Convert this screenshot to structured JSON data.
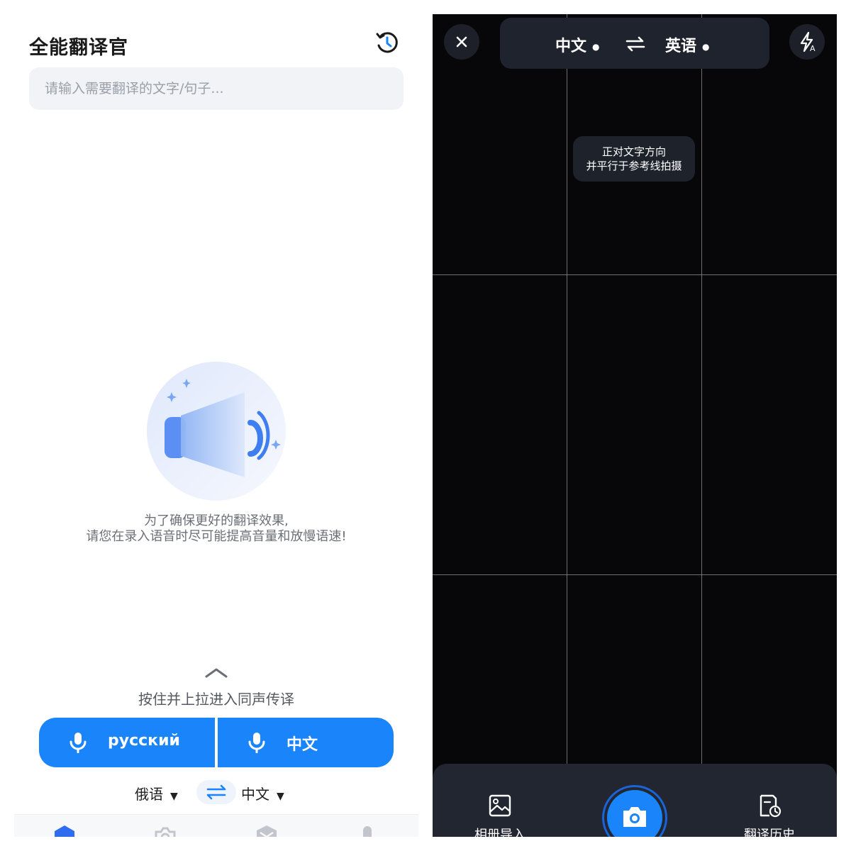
{
  "translator": {
    "title": "全能翻译官",
    "search_placeholder": "请输入需要翻译的文字/句子...",
    "tip_line1": "为了确保更好的翻译效果,",
    "tip_line2": "请您在录入语音时尽可能提高音量和放慢语速!",
    "hold_hint": "按住并上拉进入同声传译",
    "mic_left_label": "русский",
    "mic_right_label": "中文",
    "source_lang": "俄语",
    "target_lang": "中文",
    "tab_icons": [
      "home-icon",
      "camera-icon",
      "box-icon",
      "mic-icon"
    ],
    "accent_color": "#1a84fb"
  },
  "camera": {
    "source_lang": "中文",
    "target_lang": "英语",
    "guide_line1": "正对文字方向",
    "guide_line2": "并平行于参考线拍摄",
    "album_label": "相册导入",
    "history_label": "翻译历史",
    "background_color": "#07070a"
  }
}
